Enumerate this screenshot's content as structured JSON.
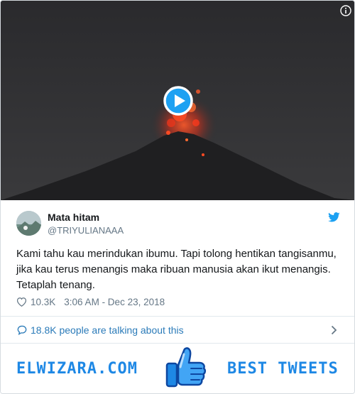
{
  "media": {
    "icons": {
      "info": "info-icon",
      "play": "play-icon"
    }
  },
  "tweet": {
    "author_name": "Mata hitam",
    "author_handle": "@TRIYULIANAAA",
    "text": "Kami tahu kau merindukan ibumu. Tapi tolong hentikan tangisanmu, jika kau terus menangis maka ribuan manusia akan ikut menangis. Tetaplah tenang.",
    "likes": "10.3K",
    "timestamp": "3:06 AM - Dec 23, 2018",
    "talking": "18.8K people are talking about this",
    "icons": {
      "brand": "twitter-bird-icon",
      "like": "heart-icon",
      "talk": "speech-bubble-icon",
      "more": "chevron-right-icon"
    }
  },
  "footer": {
    "left_brand": "ELWIZARA.COM",
    "right_label": "BEST TWEETS",
    "icon": "thumbs-up-icon"
  },
  "colors": {
    "accent": "#1da1f2",
    "link": "#2b7bb9",
    "muted": "#657786",
    "footer_blue": "#1e88e5",
    "video_bg": "#2c2c2f",
    "lava": "#ff3a1c"
  }
}
